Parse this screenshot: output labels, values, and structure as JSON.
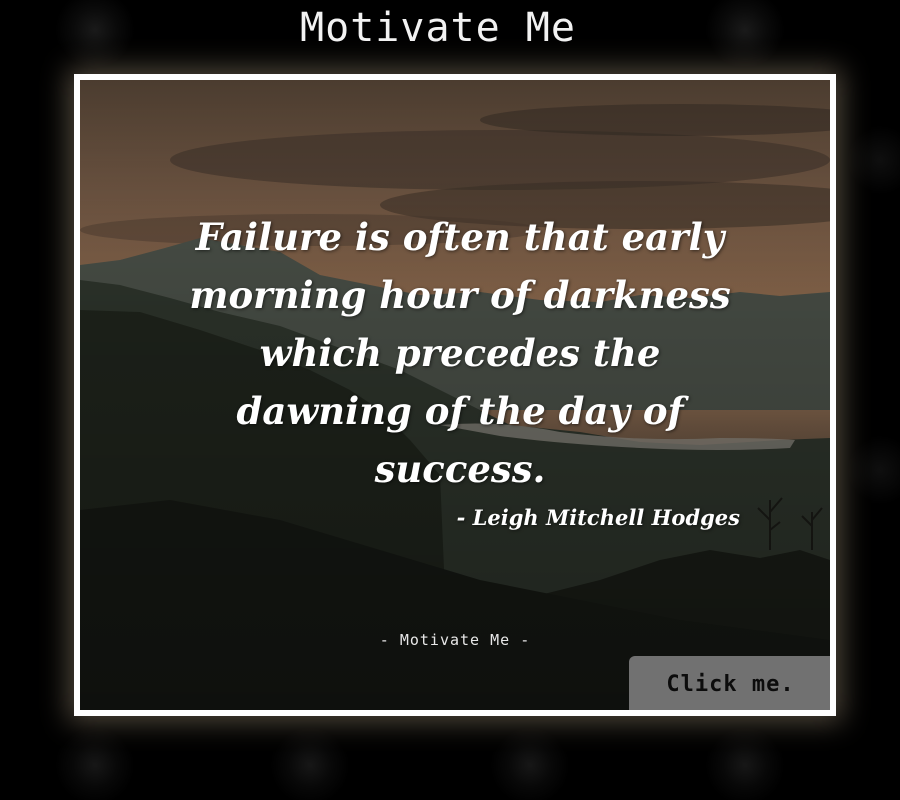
{
  "app": {
    "title": "Motivate Me"
  },
  "quote": {
    "text": "Failure is often that early morning hour of darkness which precedes the dawning of the day of success.",
    "author": "- Leigh Mitchell Hodges"
  },
  "footer": {
    "watermark": "- Motivate Me -"
  },
  "button": {
    "label": "Click me."
  },
  "colors": {
    "background": "#000000",
    "card_border": "#ffffff",
    "text": "#ffffff",
    "button_bg": "#717171",
    "button_text": "#0c0c0c"
  },
  "icons": {
    "scene": "mountain-landscape-image"
  }
}
